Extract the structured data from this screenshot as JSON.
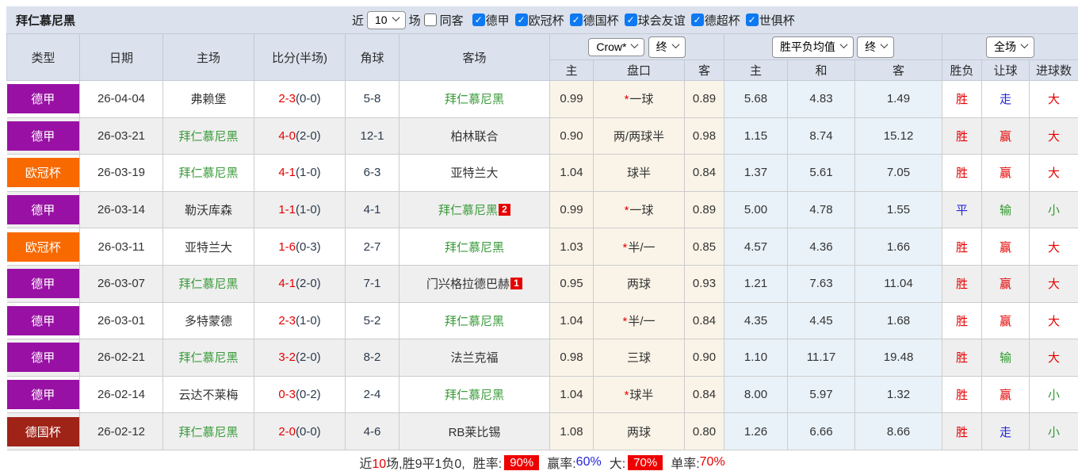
{
  "colors": {
    "red": "#e60000",
    "blue": "#2424dd",
    "green": "#2f9a2f",
    "team_green": "#3a9b3a",
    "purple": "#9911a4",
    "orange": "#f86900",
    "dark_red": "#a02318",
    "header_bg": "#dbe2ee",
    "cream": "#faf4e8",
    "light_blue": "#e9f2f9",
    "row_alt": "#efefef"
  },
  "toolbar": {
    "title": "拜仁慕尼黑",
    "near_label": "近",
    "matches_value": "10",
    "matches_label": "场",
    "same_away_label": "同客",
    "same_away_checked": false,
    "competitions": [
      {
        "label": "德甲",
        "checked": true
      },
      {
        "label": "欧冠杯",
        "checked": true
      },
      {
        "label": "德国杯",
        "checked": true
      },
      {
        "label": "球会友谊",
        "checked": true
      },
      {
        "label": "德超杯",
        "checked": true
      },
      {
        "label": "世俱杯",
        "checked": true
      }
    ]
  },
  "table": {
    "main_headers": [
      "类型",
      "日期",
      "主场",
      "比分(半场)",
      "角球",
      "客场"
    ],
    "selects": {
      "company": "Crow*",
      "company_time": "终",
      "avg": "胜平负均值",
      "avg_time": "终",
      "scope": "全场"
    },
    "sub_headers": [
      "主",
      "盘口",
      "客",
      "主",
      "和",
      "客",
      "胜负",
      "让球",
      "进球数"
    ],
    "rows": [
      {
        "type": "德甲",
        "type_color": "purple",
        "date": "26-04-04",
        "home": "弗赖堡",
        "home_team": false,
        "home_badge": "",
        "score": "2-3",
        "half": "(0-0)",
        "corner": "5-8",
        "away": "拜仁慕尼黑",
        "away_team": true,
        "away_badge": "",
        "o_home": "0.99",
        "star": true,
        "handicap": "一球",
        "o_away": "0.89",
        "avg_h": "5.68",
        "avg_d": "4.83",
        "avg_a": "1.49",
        "result": "胜",
        "result_c": "red",
        "let": "走",
        "let_c": "blue",
        "goal": "大",
        "goal_c": "red"
      },
      {
        "type": "德甲",
        "type_color": "purple",
        "date": "26-03-21",
        "home": "拜仁慕尼黑",
        "home_team": true,
        "home_badge": "",
        "score": "4-0",
        "half": "(2-0)",
        "corner": "12-1",
        "away": "柏林联合",
        "away_team": false,
        "away_badge": "",
        "o_home": "0.90",
        "star": false,
        "handicap": "两/两球半",
        "o_away": "0.98",
        "avg_h": "1.15",
        "avg_d": "8.74",
        "avg_a": "15.12",
        "result": "胜",
        "result_c": "red",
        "let": "赢",
        "let_c": "red",
        "goal": "大",
        "goal_c": "red"
      },
      {
        "type": "欧冠杯",
        "type_color": "orange",
        "date": "26-03-19",
        "home": "拜仁慕尼黑",
        "home_team": true,
        "home_badge": "",
        "score": "4-1",
        "half": "(1-0)",
        "corner": "6-3",
        "away": "亚特兰大",
        "away_team": false,
        "away_badge": "",
        "o_home": "1.04",
        "star": false,
        "handicap": "球半",
        "o_away": "0.84",
        "avg_h": "1.37",
        "avg_d": "5.61",
        "avg_a": "7.05",
        "result": "胜",
        "result_c": "red",
        "let": "赢",
        "let_c": "red",
        "goal": "大",
        "goal_c": "red"
      },
      {
        "type": "德甲",
        "type_color": "purple",
        "date": "26-03-14",
        "home": "勒沃库森",
        "home_team": false,
        "home_badge": "",
        "score": "1-1",
        "half": "(1-0)",
        "corner": "4-1",
        "away": "拜仁慕尼黑",
        "away_team": true,
        "away_badge": "2",
        "o_home": "0.99",
        "star": true,
        "handicap": "一球",
        "o_away": "0.89",
        "avg_h": "5.00",
        "avg_d": "4.78",
        "avg_a": "1.55",
        "result": "平",
        "result_c": "blue",
        "let": "输",
        "let_c": "green",
        "goal": "小",
        "goal_c": "green"
      },
      {
        "type": "欧冠杯",
        "type_color": "orange",
        "date": "26-03-11",
        "home": "亚特兰大",
        "home_team": false,
        "home_badge": "",
        "score": "1-6",
        "half": "(0-3)",
        "corner": "2-7",
        "away": "拜仁慕尼黑",
        "away_team": true,
        "away_badge": "",
        "o_home": "1.03",
        "star": true,
        "handicap": "半/一",
        "o_away": "0.85",
        "avg_h": "4.57",
        "avg_d": "4.36",
        "avg_a": "1.66",
        "result": "胜",
        "result_c": "red",
        "let": "赢",
        "let_c": "red",
        "goal": "大",
        "goal_c": "red"
      },
      {
        "type": "德甲",
        "type_color": "purple",
        "date": "26-03-07",
        "home": "拜仁慕尼黑",
        "home_team": true,
        "home_badge": "",
        "score": "4-1",
        "half": "(2-0)",
        "corner": "7-1",
        "away": "门兴格拉德巴赫",
        "away_team": false,
        "away_badge": "1",
        "o_home": "0.95",
        "star": false,
        "handicap": "两球",
        "o_away": "0.93",
        "avg_h": "1.21",
        "avg_d": "7.63",
        "avg_a": "11.04",
        "result": "胜",
        "result_c": "red",
        "let": "赢",
        "let_c": "red",
        "goal": "大",
        "goal_c": "red"
      },
      {
        "type": "德甲",
        "type_color": "purple",
        "date": "26-03-01",
        "home": "多特蒙德",
        "home_team": false,
        "home_badge": "",
        "score": "2-3",
        "half": "(1-0)",
        "corner": "5-2",
        "away": "拜仁慕尼黑",
        "away_team": true,
        "away_badge": "",
        "o_home": "1.04",
        "star": true,
        "handicap": "半/一",
        "o_away": "0.84",
        "avg_h": "4.35",
        "avg_d": "4.45",
        "avg_a": "1.68",
        "result": "胜",
        "result_c": "red",
        "let": "赢",
        "let_c": "red",
        "goal": "大",
        "goal_c": "red"
      },
      {
        "type": "德甲",
        "type_color": "purple",
        "date": "26-02-21",
        "home": "拜仁慕尼黑",
        "home_team": true,
        "home_badge": "",
        "score": "3-2",
        "half": "(2-0)",
        "corner": "8-2",
        "away": "法兰克福",
        "away_team": false,
        "away_badge": "",
        "o_home": "0.98",
        "star": false,
        "handicap": "三球",
        "o_away": "0.90",
        "avg_h": "1.10",
        "avg_d": "11.17",
        "avg_a": "19.48",
        "result": "胜",
        "result_c": "red",
        "let": "输",
        "let_c": "green",
        "goal": "大",
        "goal_c": "red"
      },
      {
        "type": "德甲",
        "type_color": "purple",
        "date": "26-02-14",
        "home": "云达不莱梅",
        "home_team": false,
        "home_badge": "",
        "score": "0-3",
        "half": "(0-2)",
        "corner": "2-4",
        "away": "拜仁慕尼黑",
        "away_team": true,
        "away_badge": "",
        "o_home": "1.04",
        "star": true,
        "handicap": "球半",
        "o_away": "0.84",
        "avg_h": "8.00",
        "avg_d": "5.97",
        "avg_a": "1.32",
        "result": "胜",
        "result_c": "red",
        "let": "赢",
        "let_c": "red",
        "goal": "小",
        "goal_c": "green"
      },
      {
        "type": "德国杯",
        "type_color": "dark_red",
        "date": "26-02-12",
        "home": "拜仁慕尼黑",
        "home_team": true,
        "home_badge": "",
        "score": "2-0",
        "half": "(0-0)",
        "corner": "4-6",
        "away": "RB莱比锡",
        "away_team": false,
        "away_badge": "",
        "o_home": "1.08",
        "star": false,
        "handicap": "两球",
        "o_away": "0.80",
        "avg_h": "1.26",
        "avg_d": "6.66",
        "avg_a": "8.66",
        "result": "胜",
        "result_c": "red",
        "let": "走",
        "let_c": "blue",
        "goal": "小",
        "goal_c": "green"
      }
    ]
  },
  "footer": {
    "prefix": "近",
    "count": "10",
    "suffix": "场,胜9平1负0,",
    "win_rate_label": "胜率:",
    "win_rate": "90%",
    "handicap_rate_label": "赢率:",
    "handicap_rate": "60%",
    "big_label": "大:",
    "big_rate": "70%",
    "single_label": "单率:",
    "single_rate": "70%"
  }
}
